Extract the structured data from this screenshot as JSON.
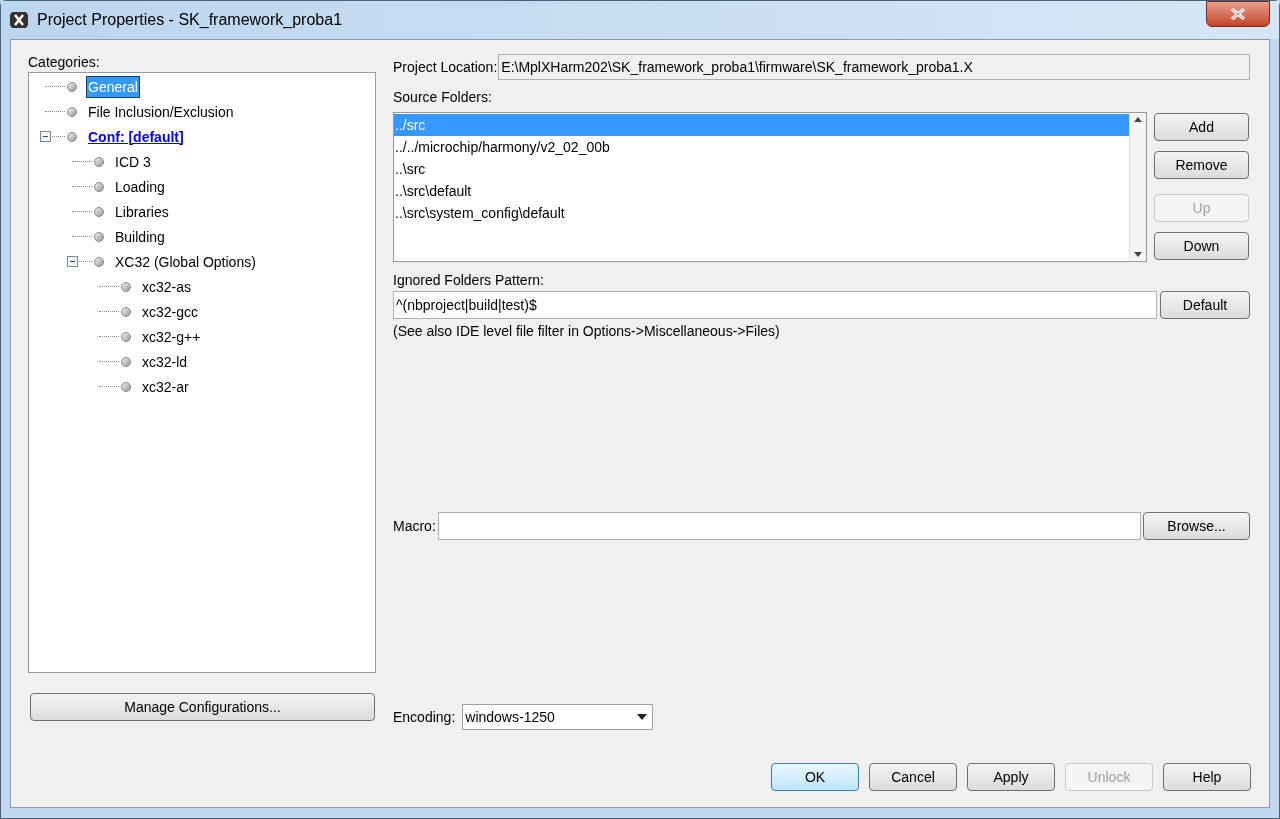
{
  "window": {
    "title": "Project Properties - SK_framework_proba1"
  },
  "categories": {
    "label": "Categories:",
    "tree": [
      {
        "label": "General",
        "kind": "item",
        "selected": true
      },
      {
        "label": "File Inclusion/Exclusion",
        "kind": "item",
        "selected": false
      },
      {
        "label": "Conf: [default]",
        "kind": "link",
        "selected": false,
        "expanded": true,
        "children": [
          {
            "label": "ICD 3",
            "kind": "item",
            "selected": false
          },
          {
            "label": "Loading",
            "kind": "item",
            "selected": false
          },
          {
            "label": "Libraries",
            "kind": "item",
            "selected": false
          },
          {
            "label": "Building",
            "kind": "item",
            "selected": false
          },
          {
            "label": "XC32 (Global Options)",
            "kind": "item",
            "selected": false,
            "expanded": true,
            "children": [
              {
                "label": "xc32-as",
                "kind": "item",
                "selected": false
              },
              {
                "label": "xc32-gcc",
                "kind": "item",
                "selected": false
              },
              {
                "label": "xc32-g++",
                "kind": "item",
                "selected": false
              },
              {
                "label": "xc32-ld",
                "kind": "item",
                "selected": false
              },
              {
                "label": "xc32-ar",
                "kind": "item",
                "selected": false
              }
            ]
          }
        ]
      }
    ],
    "manage_button": "Manage Configurations..."
  },
  "project_location": {
    "label": "Project Location:",
    "value": "E:\\MplXHarm202\\SK_framework_proba1\\firmware\\SK_framework_proba1.X"
  },
  "source_folders": {
    "label": "Source Folders:",
    "items": [
      {
        "path": "../src",
        "selected": true
      },
      {
        "path": "../../microchip/harmony/v2_02_00b",
        "selected": false
      },
      {
        "path": "..\\src",
        "selected": false
      },
      {
        "path": "..\\src\\default",
        "selected": false
      },
      {
        "path": "..\\src\\system_config\\default",
        "selected": false
      }
    ],
    "buttons": [
      {
        "label": "Add",
        "disabled": false
      },
      {
        "label": "Remove",
        "disabled": false
      },
      {
        "label": "Up",
        "disabled": true
      },
      {
        "label": "Down",
        "disabled": false
      }
    ]
  },
  "ignored_folders": {
    "label": "Ignored Folders Pattern:",
    "value": "^(nbproject|build|test)$",
    "button": "Default",
    "note": "(See also IDE level file filter in Options->Miscellaneous->Files)"
  },
  "macro": {
    "label": "Macro:",
    "button": "Browse..."
  },
  "encoding": {
    "label": "Encoding:",
    "value": "windows-1250"
  },
  "buttons": [
    {
      "label": "OK",
      "disabled": false,
      "default": true
    },
    {
      "label": "Cancel",
      "disabled": false,
      "default": false
    },
    {
      "label": "Apply",
      "disabled": false,
      "default": false
    },
    {
      "label": "Unlock",
      "disabled": true,
      "default": false
    },
    {
      "label": "Help",
      "disabled": false,
      "default": false
    }
  ]
}
